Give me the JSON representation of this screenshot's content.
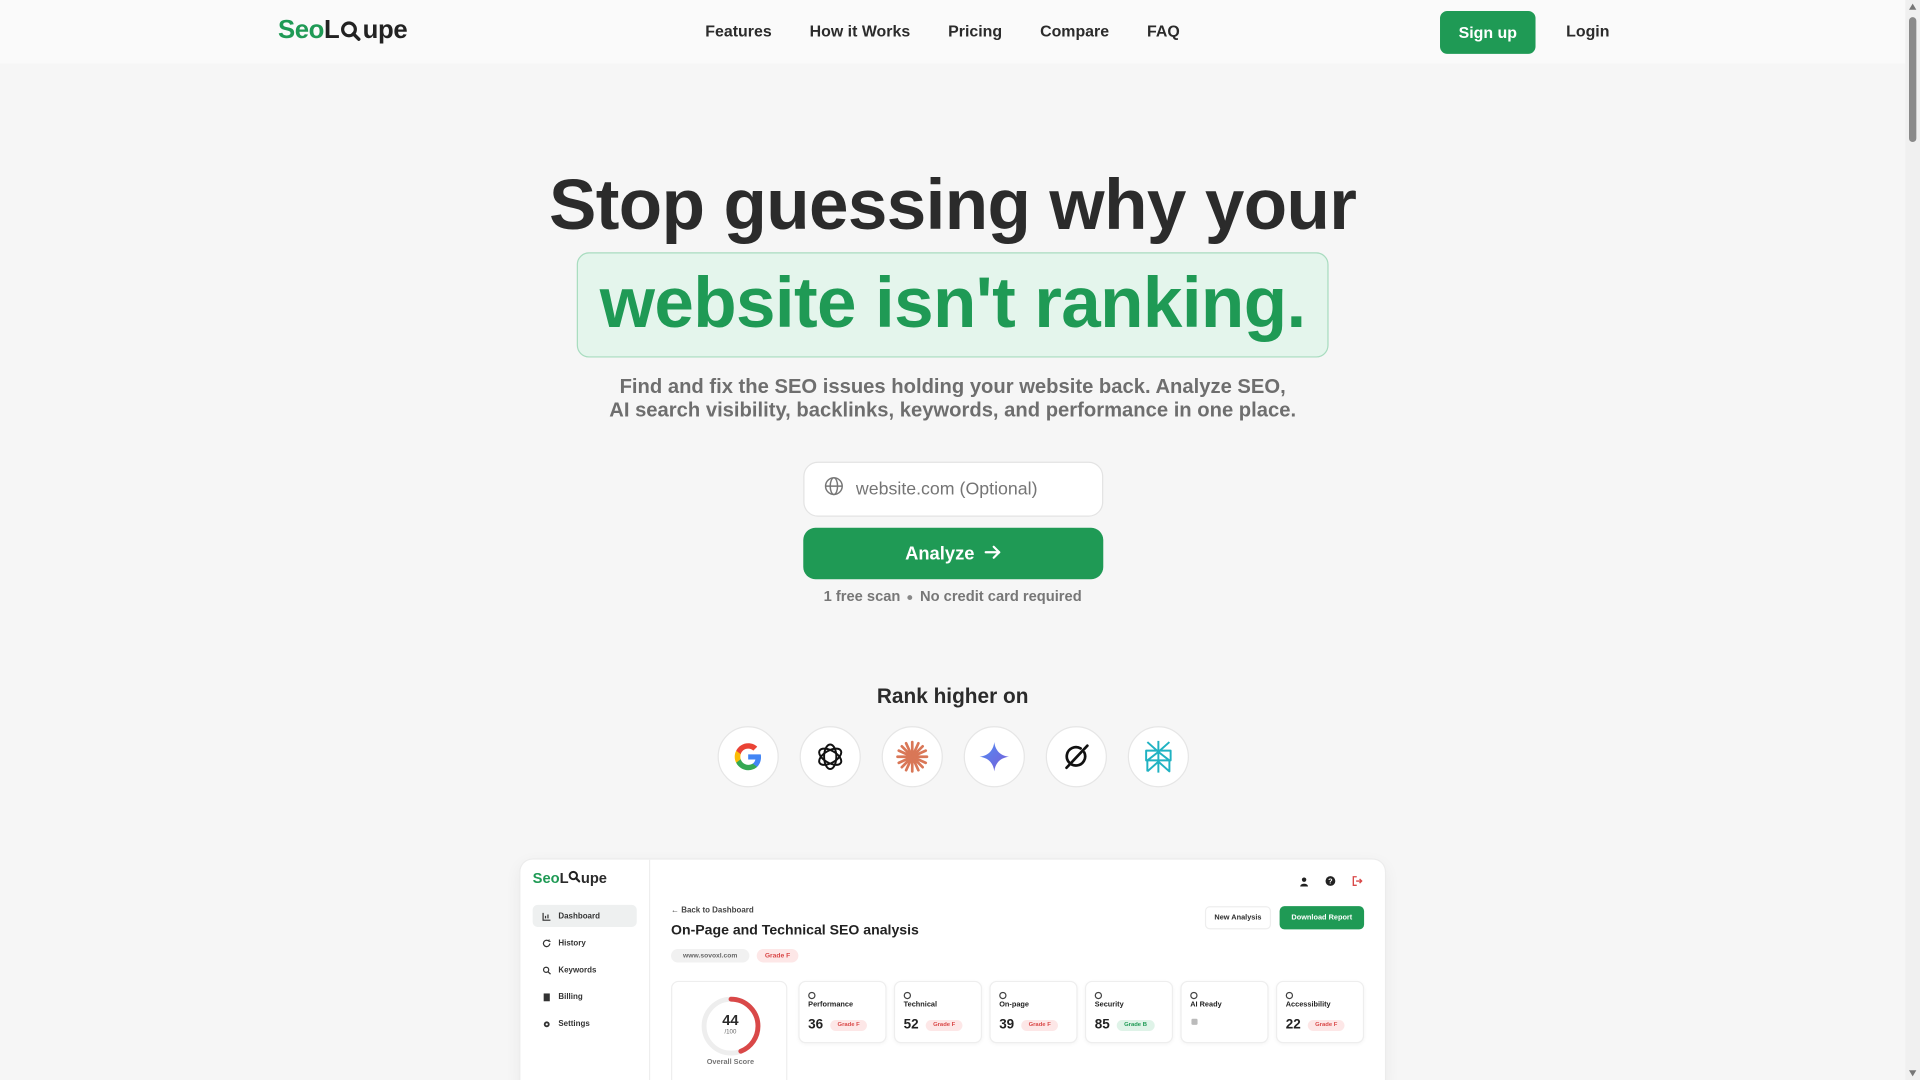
{
  "brand": {
    "logo_left": "Seo",
    "logo_right": "upe",
    "logo_letter": "L"
  },
  "nav": {
    "links": [
      "Features",
      "How it Works",
      "Pricing",
      "Compare",
      "FAQ"
    ],
    "signup": "Sign up",
    "login": "Login"
  },
  "hero": {
    "line1": "Stop guessing why your",
    "line2": "website isn't ranking.",
    "sub1": "Find and fix the SEO issues holding your website back. Analyze SEO,",
    "sub2": "AI search visibility, backlinks, keywords, and performance in one place.",
    "input_placeholder": "website.com (Optional)",
    "analyze": "Analyze",
    "free_scan": "1 free scan",
    "no_card": "No credit card required"
  },
  "rank": {
    "title": "Rank higher on",
    "engines": [
      "google-icon",
      "chatgpt-icon",
      "claude-icon",
      "gemini-icon",
      "grok-icon",
      "perplexity-icon"
    ]
  },
  "dashboard": {
    "logo_left": "Seo",
    "logo_right": "upe",
    "logo_letter": "L",
    "sidebar": [
      "Dashboard",
      "History",
      "Keywords",
      "Billing",
      "Settings"
    ],
    "back": "Back to Dashboard",
    "title": "On-Page and Technical SEO analysis",
    "domain_chip": "www.sovoxl.com",
    "grade_chip": "Grade F",
    "new_analysis": "New Analysis",
    "download": "Download Report",
    "overall": {
      "score": "44",
      "out_of": "/100",
      "label": "Overall Score",
      "value": 44
    },
    "cards": [
      {
        "label": "Performance",
        "value": "36",
        "grade": "Grade F"
      },
      {
        "label": "Technical",
        "value": "52",
        "grade": "Grade F"
      },
      {
        "label": "On-page",
        "value": "39",
        "grade": "Grade F"
      },
      {
        "label": "Security",
        "value": "85",
        "grade": "Grade B"
      },
      {
        "label": "AI Ready",
        "value": "",
        "grade": ""
      },
      {
        "label": "Accessibility",
        "value": "22",
        "grade": "Grade F"
      }
    ]
  },
  "colors": {
    "brand_green": "#1f9a55",
    "highlight_bg": "#e4f5ec",
    "bad": "#d94848"
  }
}
